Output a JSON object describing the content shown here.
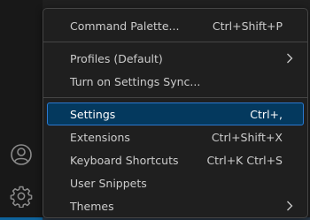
{
  "menu": {
    "groups": [
      {
        "items": [
          {
            "label": "Command Palette...",
            "shortcut": "Ctrl+Shift+P"
          }
        ]
      },
      {
        "items": [
          {
            "label": "Profiles (Default)",
            "submenu": true
          },
          {
            "label": "Turn on Settings Sync..."
          }
        ]
      },
      {
        "items": [
          {
            "label": "Settings",
            "shortcut": "Ctrl+,",
            "active": true
          },
          {
            "label": "Extensions",
            "shortcut": "Ctrl+Shift+X"
          },
          {
            "label": "Keyboard Shortcuts",
            "shortcut": "Ctrl+K Ctrl+S"
          },
          {
            "label": "User Snippets"
          },
          {
            "label": "Themes",
            "submenu": true
          }
        ]
      }
    ]
  },
  "activity_bar": {
    "icons": [
      "accounts-icon",
      "manage-gear-icon"
    ]
  },
  "colors": {
    "menu_bg": "#1f1f1f",
    "active_bg": "#04395e",
    "active_border": "#2b79d0",
    "text": "#cccccc"
  }
}
